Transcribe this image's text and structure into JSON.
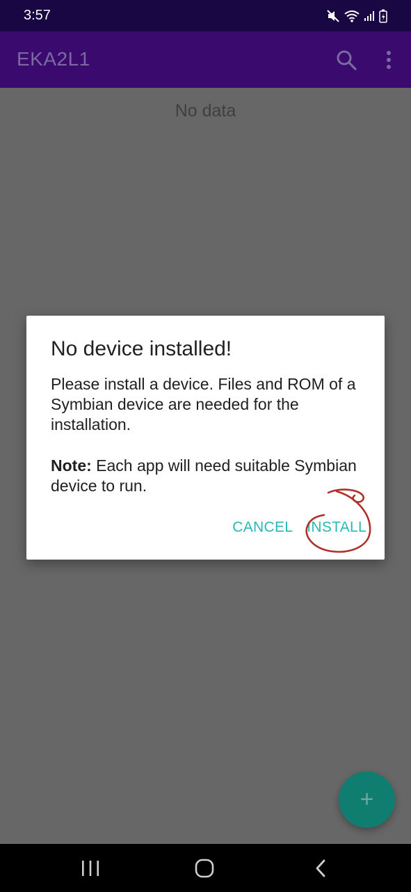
{
  "status_bar": {
    "time": "3:57",
    "icons": [
      "mute-icon",
      "wifi-icon",
      "signal-icon",
      "battery-icon"
    ]
  },
  "app_bar": {
    "title": "EKA2L1",
    "icons": [
      "search-icon",
      "more-vert-icon"
    ]
  },
  "content": {
    "empty_text": "No data"
  },
  "dialog": {
    "title": "No device installed!",
    "body": "Please install a device. Files and ROM of a Symbian device are needed for the installation.",
    "note_label": "Note:",
    "note_text": " Each app will need suitable Symbian device to run.",
    "cancel_label": "CANCEL",
    "install_label": "INSTALL"
  },
  "fab": {
    "label": "+"
  },
  "nav_bar": {
    "icons": [
      "recent-apps-icon",
      "home-icon",
      "back-icon"
    ]
  },
  "colors": {
    "status_bar": "#180742",
    "app_bar": "#3a0a6f",
    "accent": "#27b9b3",
    "fab": "#0f7e70",
    "annotation": "#b0302a"
  }
}
